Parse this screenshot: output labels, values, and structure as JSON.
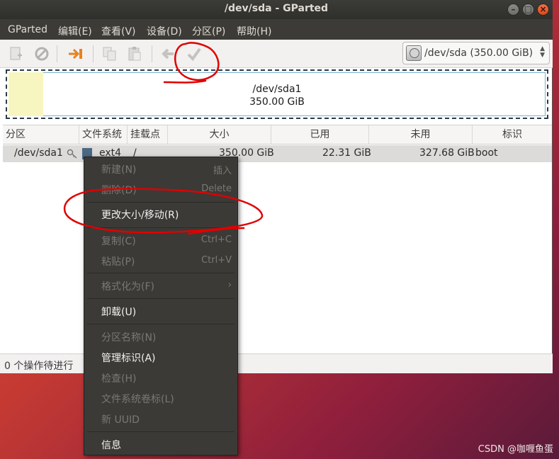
{
  "window": {
    "title": "/dev/sda - GParted",
    "controls": {
      "minimize": "–",
      "maximize": "□",
      "close": "×"
    }
  },
  "menubar": {
    "items": [
      "GParted",
      "编辑(E)",
      "查看(V)",
      "设备(D)",
      "分区(P)",
      "帮助(H)"
    ]
  },
  "toolbar": {
    "device_selector": "/dev/sda (350.00 GiB)"
  },
  "diskmap": {
    "partition_name": "/dev/sda1",
    "partition_size": "350.00 GiB",
    "used_fraction": 0.064
  },
  "table": {
    "columns": [
      "分区",
      "文件系统",
      "挂载点",
      "大小",
      "已用",
      "未用",
      "标识"
    ],
    "rows": [
      {
        "partition": "/dev/sda1",
        "filesystem": "ext4",
        "mount": "/",
        "size": "350.00 GiB",
        "used": "22.31 GiB",
        "unused": "327.68 GiB",
        "flags": "boot"
      }
    ]
  },
  "statusbar": {
    "text": "0 个操作待进行"
  },
  "context_menu": {
    "items": [
      {
        "label": "新建(N)",
        "accel": "插入",
        "enabled": false
      },
      {
        "label": "删除(D)",
        "accel": "Delete",
        "enabled": false
      },
      {
        "label": "更改大小/移动(R)",
        "accel": "",
        "enabled": true
      },
      {
        "label": "复制(C)",
        "accel": "Ctrl+C",
        "enabled": false
      },
      {
        "label": "粘贴(P)",
        "accel": "Ctrl+V",
        "enabled": false
      },
      {
        "label": "格式化为(F)",
        "accel": "›",
        "enabled": false
      },
      {
        "label": "卸载(U)",
        "accel": "",
        "enabled": true
      },
      {
        "label": "分区名称(N)",
        "accel": "",
        "enabled": false
      },
      {
        "label": "管理标识(A)",
        "accel": "",
        "enabled": true
      },
      {
        "label": "检查(H)",
        "accel": "",
        "enabled": false
      },
      {
        "label": "文件系统卷标(L)",
        "accel": "",
        "enabled": false
      },
      {
        "label": "新 UUID",
        "accel": "",
        "enabled": false
      },
      {
        "label": "信息",
        "accel": "",
        "enabled": true
      }
    ]
  },
  "watermark": "CSDN @咖喱鱼蛋",
  "colors": {
    "titlebar": "#3c3b37",
    "close_button": "#df4a16",
    "partition_used": "#f7f6c0",
    "ext4_fs": "#4b6983",
    "annotation_red": "#e00000"
  }
}
